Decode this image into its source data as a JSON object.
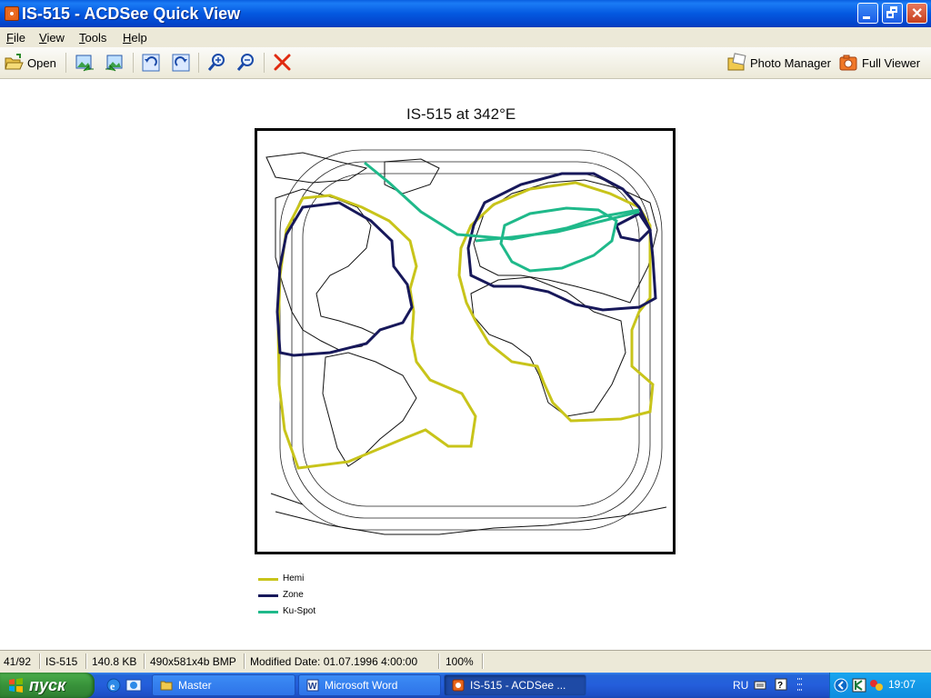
{
  "window": {
    "title": "IS-515 - ACDSee Quick View"
  },
  "menu": {
    "items": [
      "File",
      "View",
      "Tools",
      "Help"
    ]
  },
  "toolbar": {
    "open_label": "Open",
    "photo_manager_label": "Photo Manager",
    "full_viewer_label": "Full Viewer",
    "icons": [
      "open-folder-icon",
      "previous-image-icon",
      "next-image-icon",
      "rotate-left-icon",
      "rotate-right-icon",
      "zoom-in-icon",
      "zoom-out-icon",
      "delete-icon"
    ]
  },
  "image": {
    "title": "IS-515 at 342°E",
    "legend": [
      {
        "label": "Hemi",
        "color": "#c8c41a"
      },
      {
        "label": "Zone",
        "color": "#17185a"
      },
      {
        "label": "Ku-Spot",
        "color": "#1fb98a"
      }
    ]
  },
  "status": {
    "position": "41/92",
    "name": "IS-515",
    "size": "140.8 KB",
    "dimensions": "490x581x4b BMP",
    "modified": "Modified Date: 01.07.1996 4:00:00",
    "zoom": "100%"
  },
  "taskbar": {
    "start_label": "пуск",
    "tasks": [
      {
        "label": "Master",
        "active": false
      },
      {
        "label": "Microsoft Word",
        "active": false
      },
      {
        "label": "IS-515 - ACDSee ...",
        "active": true
      }
    ],
    "language": "RU",
    "clock": "19:07"
  }
}
